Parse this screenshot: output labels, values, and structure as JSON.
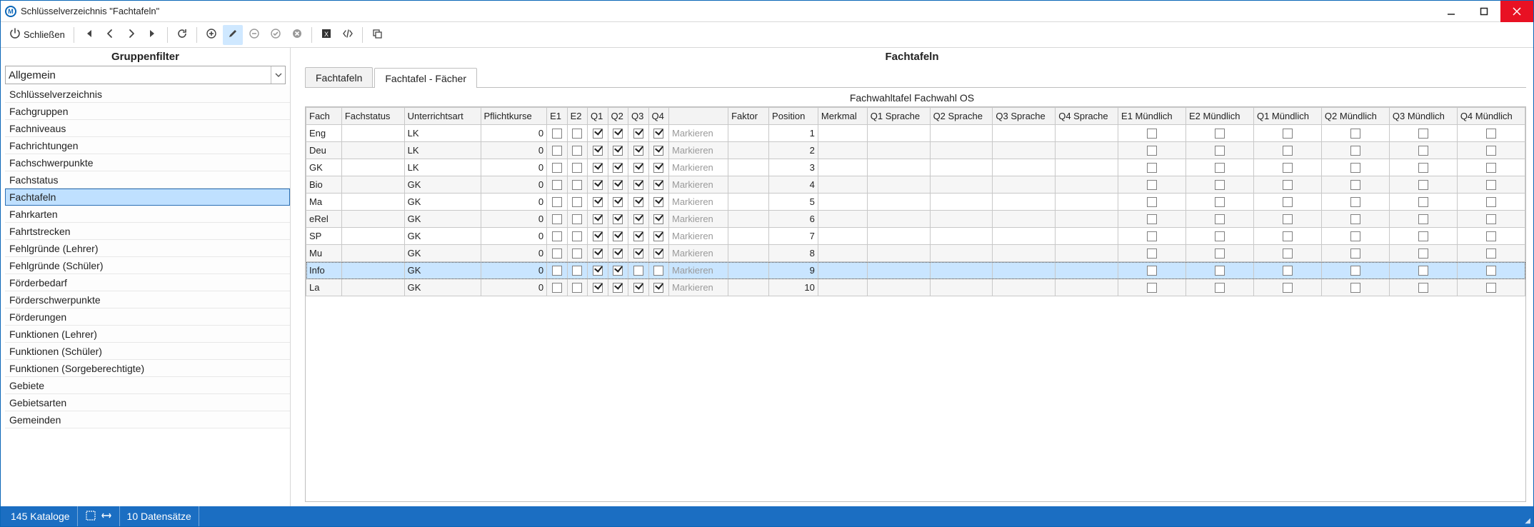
{
  "window": {
    "title": "Schlüsselverzeichnis \"Fachtafeln\""
  },
  "toolbar": {
    "close_label": "Schließen"
  },
  "left": {
    "header": "Gruppenfilter",
    "combo_value": "Allgemein",
    "items": [
      "Schlüsselverzeichnis",
      "Fachgruppen",
      "Fachniveaus",
      "Fachrichtungen",
      "Fachschwerpunkte",
      "Fachstatus",
      "Fachtafeln",
      "Fahrkarten",
      "Fahrtstrecken",
      "Fehlgründe (Lehrer)",
      "Fehlgründe (Schüler)",
      "Förderbedarf",
      "Förderschwerpunkte",
      "Förderungen",
      "Funktionen (Lehrer)",
      "Funktionen (Schüler)",
      "Funktionen (Sorgeberechtigte)",
      "Gebiete",
      "Gebietsarten",
      "Gemeinden"
    ],
    "selected_index": 6
  },
  "right": {
    "header": "Fachtafeln",
    "tabs": [
      "Fachtafeln",
      "Fachtafel - Fächer"
    ],
    "active_tab": 1,
    "subtitle": "Fachwahltafel Fachwahl OS",
    "columns": [
      "Fach",
      "Fachstatus",
      "Unterrichtsart",
      "Pflichtkurse",
      "E1",
      "E2",
      "Q1",
      "Q2",
      "Q3",
      "Q4",
      "",
      "Faktor",
      "Position",
      "Merkmal",
      "Q1 Sprache",
      "Q2 Sprache",
      "Q3 Sprache",
      "Q4 Sprache",
      "E1 Mündlich",
      "E2 Mündlich",
      "Q1 Mündlich",
      "Q2 Mündlich",
      "Q3 Mündlich",
      "Q4 Mündlich"
    ],
    "mark_label": "Markieren",
    "rows": [
      {
        "fach": "Eng",
        "fachstatus": "",
        "ua": "LK",
        "pk": 0,
        "e1": false,
        "e2": false,
        "q1": true,
        "q2": true,
        "q3": true,
        "q4": true,
        "faktor": "",
        "position": 1
      },
      {
        "fach": "Deu",
        "fachstatus": "",
        "ua": "LK",
        "pk": 0,
        "e1": false,
        "e2": false,
        "q1": true,
        "q2": true,
        "q3": true,
        "q4": true,
        "faktor": "",
        "position": 2
      },
      {
        "fach": "GK",
        "fachstatus": "",
        "ua": "LK",
        "pk": 0,
        "e1": false,
        "e2": false,
        "q1": true,
        "q2": true,
        "q3": true,
        "q4": true,
        "faktor": "",
        "position": 3
      },
      {
        "fach": "Bio",
        "fachstatus": "",
        "ua": "GK",
        "pk": 0,
        "e1": false,
        "e2": false,
        "q1": true,
        "q2": true,
        "q3": true,
        "q4": true,
        "faktor": "",
        "position": 4
      },
      {
        "fach": "Ma",
        "fachstatus": "",
        "ua": "GK",
        "pk": 0,
        "e1": false,
        "e2": false,
        "q1": true,
        "q2": true,
        "q3": true,
        "q4": true,
        "faktor": "",
        "position": 5
      },
      {
        "fach": "eRel",
        "fachstatus": "",
        "ua": "GK",
        "pk": 0,
        "e1": false,
        "e2": false,
        "q1": true,
        "q2": true,
        "q3": true,
        "q4": true,
        "faktor": "",
        "position": 6
      },
      {
        "fach": "SP",
        "fachstatus": "",
        "ua": "GK",
        "pk": 0,
        "e1": false,
        "e2": false,
        "q1": true,
        "q2": true,
        "q3": true,
        "q4": true,
        "faktor": "",
        "position": 7
      },
      {
        "fach": "Mu",
        "fachstatus": "",
        "ua": "GK",
        "pk": 0,
        "e1": false,
        "e2": false,
        "q1": true,
        "q2": true,
        "q3": true,
        "q4": true,
        "faktor": "",
        "position": 8
      },
      {
        "fach": "Info",
        "fachstatus": "",
        "ua": "GK",
        "pk": 0,
        "e1": false,
        "e2": false,
        "q1": true,
        "q2": true,
        "q3": false,
        "q4": false,
        "faktor": "",
        "position": 9,
        "selected": true
      },
      {
        "fach": "La",
        "fachstatus": "",
        "ua": "GK",
        "pk": 0,
        "e1": false,
        "e2": false,
        "q1": true,
        "q2": true,
        "q3": true,
        "q4": true,
        "faktor": "",
        "position": 10
      }
    ]
  },
  "status": {
    "catalog_count": "145 Kataloge",
    "record_count": "10 Datensätze"
  }
}
